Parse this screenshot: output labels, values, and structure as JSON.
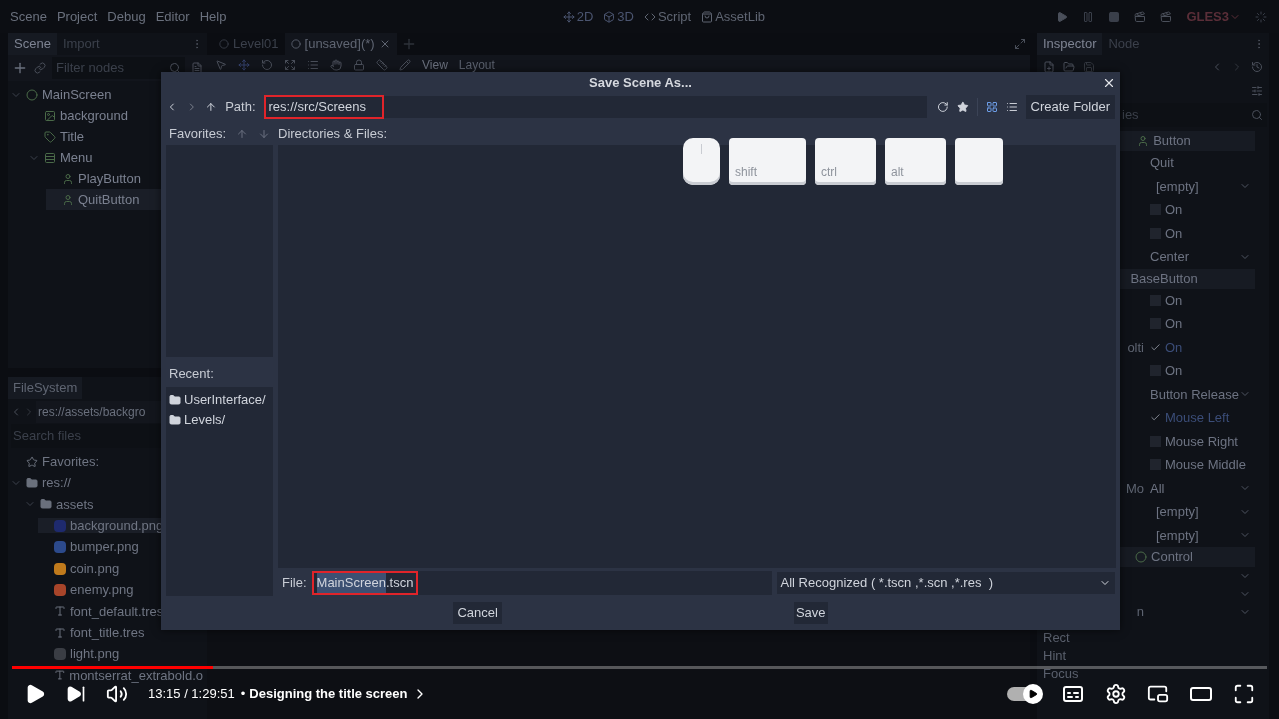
{
  "menu": [
    "Scene",
    "Project",
    "Debug",
    "Editor",
    "Help"
  ],
  "workspaces": [
    {
      "kind": "planar",
      "label": "2D"
    },
    {
      "kind": "spatial",
      "label": "3D"
    },
    {
      "kind": "script",
      "label": "Script"
    },
    {
      "kind": "assetlib",
      "label": "AssetLib"
    }
  ],
  "renderer": "GLES3",
  "scene_dock": {
    "tabs": [
      {
        "label": "Scene",
        "selected": true
      },
      {
        "label": "Import",
        "selected": false
      }
    ],
    "filter_placeholder": "Filter nodes",
    "tree": [
      {
        "label": "MainScreen",
        "kind": "control",
        "expanded": true,
        "selected": false,
        "children": [
          {
            "label": "background",
            "kind": "texture",
            "selected": false
          },
          {
            "label": "Title",
            "kind": "label",
            "selected": false
          },
          {
            "label": "Menu",
            "kind": "container",
            "expanded": true,
            "selected": false,
            "children": [
              {
                "label": "PlayButton",
                "kind": "button",
                "selected": false
              },
              {
                "label": "QuitButton",
                "kind": "button",
                "selected": true
              }
            ]
          }
        ]
      }
    ]
  },
  "filesystem": {
    "title": "FileSystem",
    "path": "res://assets/backgro",
    "search_placeholder": "Search files",
    "tree": [
      {
        "label": "Favorites:",
        "kind": "favorites",
        "selected": false
      },
      {
        "label": "res://",
        "kind": "folder",
        "expanded": true,
        "selected": false,
        "children": [
          {
            "label": "assets",
            "kind": "folder",
            "expanded": true,
            "selected": false,
            "children": [
              {
                "label": "background.png",
                "kind": "image",
                "color": "#1e2a6e",
                "selected": true
              },
              {
                "label": "bumper.png",
                "kind": "image",
                "color": "#2c4a8c",
                "selected": false
              },
              {
                "label": "coin.png",
                "kind": "image",
                "color": "#c07a1c",
                "selected": false
              },
              {
                "label": "enemy.png",
                "kind": "image",
                "color": "#a8452a",
                "selected": false
              },
              {
                "label": "font_default.tres",
                "kind": "font",
                "selected": false
              },
              {
                "label": "font_title.tres",
                "kind": "font",
                "selected": false
              },
              {
                "label": "light.png",
                "kind": "image",
                "color": "#3a3d44",
                "selected": false
              },
              {
                "label": "montserrat_extrabold.o",
                "kind": "font",
                "selected": false
              }
            ]
          }
        ]
      }
    ]
  },
  "editor_tabs": [
    {
      "label": "Level01",
      "selected": false
    },
    {
      "label": "[unsaved](*)",
      "selected": true
    }
  ],
  "toolbar": {
    "view": "View",
    "layout": "Layout"
  },
  "inspector": {
    "tabs": [
      {
        "label": "Inspector",
        "selected": true
      },
      {
        "label": "Node",
        "selected": false
      }
    ],
    "filter_placeholder": "ies",
    "rows": [
      {
        "kind": "buttonclass",
        "label": "Button"
      },
      {
        "kind": "text",
        "value": "Quit"
      },
      {
        "kind": "dropdown",
        "value": "[empty]"
      },
      {
        "kind": "check",
        "value": "On",
        "checked": false
      },
      {
        "kind": "check",
        "value": "On",
        "checked": false
      },
      {
        "kind": "dropdown",
        "value": "Center"
      },
      {
        "kind": "section",
        "label": "BaseButton"
      },
      {
        "kind": "check",
        "value": "On",
        "checked": false
      },
      {
        "kind": "check",
        "value": "On",
        "checked": false
      },
      {
        "kind": "check",
        "label": "olti",
        "value": "On",
        "checked": true
      },
      {
        "kind": "check",
        "value": "On",
        "checked": false
      },
      {
        "kind": "dropdown",
        "value": "Button Release"
      },
      {
        "kind": "check",
        "value": "Mouse Left",
        "checked": true
      },
      {
        "kind": "check",
        "value": "Mouse Right",
        "checked": false
      },
      {
        "kind": "check",
        "value": "Mouse Middle",
        "checked": false
      },
      {
        "kind": "dropdown",
        "label": "Mo",
        "value": "All"
      },
      {
        "kind": "dropdown",
        "value": "[empty]"
      },
      {
        "kind": "dropdown",
        "value": "[empty]"
      },
      {
        "kind": "controlclass",
        "label": "Control"
      },
      {
        "kind": "dropdown"
      },
      {
        "kind": "dropdown"
      },
      {
        "kind": "dropdown",
        "label": "n"
      },
      {
        "kind": "label",
        "label": "Rect"
      },
      {
        "kind": "label",
        "label": "Hint"
      },
      {
        "kind": "label",
        "label": "Focus"
      }
    ]
  },
  "dialog": {
    "title": "Save Scene As...",
    "path_label": "Path:",
    "path": "res://src/Screens",
    "path_highlighted": true,
    "view_modes": [
      {
        "kind": "grid",
        "selected": true
      },
      {
        "kind": "list",
        "selected": false
      }
    ],
    "create_folder": "Create Folder",
    "favorites_label": "Favorites:",
    "directories_label": "Directories & Files:",
    "recent_label": "Recent:",
    "recent": [
      "UserInterface/",
      "Levels/"
    ],
    "file_label": "File:",
    "file_selected_part": "MainScreen",
    "file_rest": ".tscn",
    "file_highlighted": true,
    "filter": "All Recognized ( *.tscn ,*.scn ,*.res  )",
    "cancel": "Cancel",
    "save": "Save"
  },
  "key_overlay": [
    {
      "kind": "mouse"
    },
    {
      "kind": "key",
      "label": "shift"
    },
    {
      "kind": "key",
      "label": "ctrl"
    },
    {
      "kind": "key",
      "label": "alt"
    },
    {
      "kind": "key"
    }
  ],
  "player": {
    "level": 0.16,
    "time": "13:15 / 1:29:51",
    "separator": "•",
    "chapter": "Designing the title screen",
    "autoplay": true
  }
}
